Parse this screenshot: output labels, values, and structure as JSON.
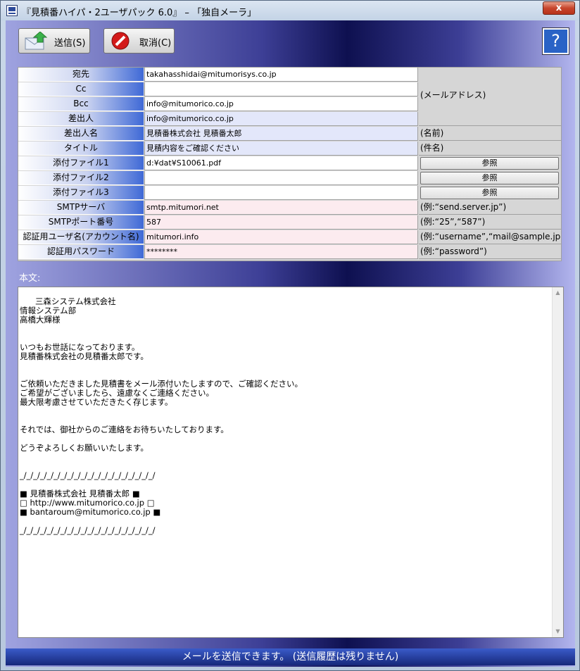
{
  "window": {
    "title": "『見積番ハイパ・2ユーザパック 6.0』 – 「独自メーラ」",
    "close_label": "x"
  },
  "toolbar": {
    "send_label": "送信(S)",
    "cancel_label": "取消(C)",
    "help_label": "?"
  },
  "form": {
    "rows": [
      {
        "label": "宛先",
        "value": "takahasshidai@mitumorisys.co.jp"
      },
      {
        "label": "Cc",
        "value": ""
      },
      {
        "label": "Bcc",
        "value": "info@mitumorico.co.jp"
      },
      {
        "label": "差出人",
        "value": "info@mitumorico.co.jp"
      },
      {
        "label": "差出人名",
        "value": "見積番株式会社 見積番太郎",
        "note": "(名前)"
      },
      {
        "label": "タイトル",
        "value": "見積内容をご確認ください",
        "note": "(件名)"
      },
      {
        "label": "添付ファイル1",
        "value": "d:¥dat¥S10061.pdf",
        "button": "参照"
      },
      {
        "label": "添付ファイル2",
        "value": "",
        "button": "参照"
      },
      {
        "label": "添付ファイル3",
        "value": "",
        "button": "参照"
      },
      {
        "label": "SMTPサーバ",
        "value": "smtp.mitumori.net",
        "note": "(例:“send.server.jp”)"
      },
      {
        "label": "SMTPポート番号",
        "value": "587",
        "note": "(例:“25”,“587”)"
      },
      {
        "label": "認証用ユーザ名(アカウント名)",
        "value": "mitumori.info",
        "note": "(例:“username”,“mail@sample.jp”)"
      },
      {
        "label": "認証用パスワード",
        "value": "********",
        "note": "(例:“password”)"
      }
    ],
    "mail_address_note": "(メールアドレス)"
  },
  "body": {
    "label": "本文:",
    "text": "三森システム株式会社\n情報システム部\n高橋大輝様\n\n\nいつもお世話になっております。\n見積番株式会社の見積番太郎です。\n\n\nご依頼いただきました見積書をメール添付いたしますので、ご確認ください。\nご希望がございましたら、遠慮なくご連絡ください。\n最大限考慮させていただきたく存じます。\n\n\nそれでは、御社からのご連絡をお待ちいたしております。\n\nどうぞよろしくお願いいたします。\n\n\n_/_/_/_/_/_/_/_/_/_/_/_/_/_/_/_/_/_/_/_/\n\n■ 見積番株式会社 見積番太郎 ■\n□ http://www.mitumorico.co.jp □\n■ bantaroum@mitumorico.co.jp ■\n\n_/_/_/_/_/_/_/_/_/_/_/_/_/_/_/_/_/_/_/_/"
  },
  "status": {
    "text": "メールを送信できます。 (送信履歴は残りません)"
  },
  "colors": {
    "label_gradient_end": "#3f69d6",
    "status_bar": "#17287a",
    "cancel_icon": "#d31a1a",
    "send_arrow": "#3ab24a"
  }
}
